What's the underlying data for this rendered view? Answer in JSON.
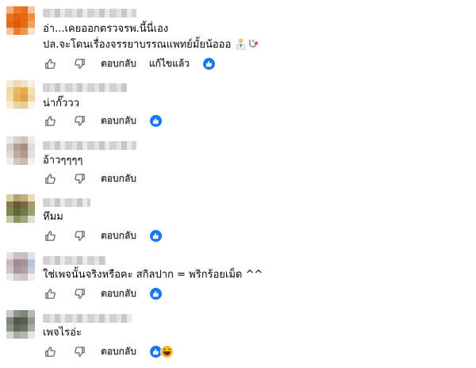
{
  "actions": {
    "reply": "ตอบกลับ",
    "edit": "แก้ไขแล้ว"
  },
  "comments": [
    {
      "lines": [
        "อ่า...เคยออกตรวจรพ.นี้นี่เอง",
        "ปล.จะโดนเรื่องจรรยาบรรณแพทย์มั้ยน้อออ"
      ],
      "trailing_icons": [
        "doctor-emoji-icon",
        "stethoscope-emoji-icon"
      ],
      "edited": true,
      "reactions": [
        "like"
      ]
    },
    {
      "lines": [
        "น่ากั๊ววว"
      ],
      "edited": false,
      "reactions": [
        "like"
      ]
    },
    {
      "lines": [
        "อ้าวๆๆๆๆ"
      ],
      "edited": false,
      "reactions": []
    },
    {
      "lines": [
        "หึมม"
      ],
      "edited": false,
      "reactions": [
        "like"
      ]
    },
    {
      "lines": [
        "ใช่เพจนั้นจริงหรือคะ สกิลปาก = พริกร้อยเม็ด ^^"
      ],
      "edited": false,
      "reactions": [
        "like"
      ]
    },
    {
      "lines": [
        "เพจไรอ่ะ"
      ],
      "edited": false,
      "reactions": [
        "like",
        "haha"
      ]
    }
  ]
}
